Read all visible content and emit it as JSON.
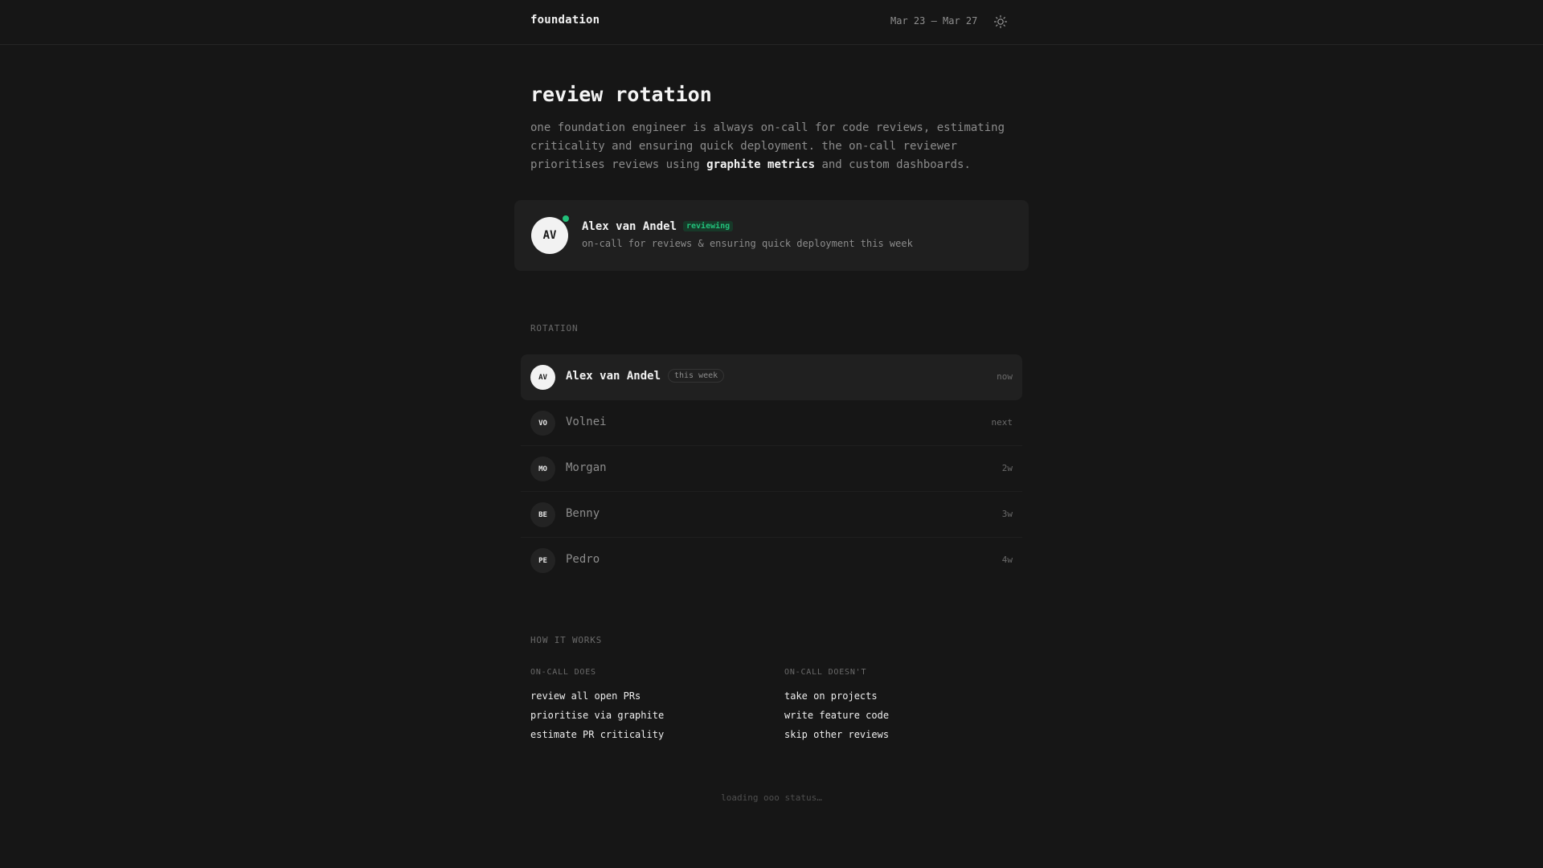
{
  "header": {
    "brand": "foundation",
    "date_range": "Mar 23 – Mar 27",
    "theme_icon": "sun-icon"
  },
  "page": {
    "title": "review rotation",
    "intro_before": "one foundation engineer is always on-call for code reviews, estimating criticality and ensuring quick deployment. the on-call reviewer prioritises reviews using ",
    "intro_link": "graphite metrics",
    "intro_after": " and custom dashboards."
  },
  "oncall": {
    "initials": "AV",
    "name": "Alex van Andel",
    "status_badge": "reviewing",
    "status_color": "#22c07a",
    "description": "on-call for reviews & ensuring quick deployment this week"
  },
  "rotation": {
    "label": "ROTATION",
    "members": [
      {
        "initials": "AV",
        "name": "Alex van Andel",
        "badge": "this week",
        "when": "now"
      },
      {
        "initials": "VO",
        "name": "Volnei",
        "when": "next"
      },
      {
        "initials": "MO",
        "name": "Morgan",
        "when": "2w"
      },
      {
        "initials": "BE",
        "name": "Benny",
        "when": "3w"
      },
      {
        "initials": "PE",
        "name": "Pedro",
        "when": "4w"
      }
    ]
  },
  "how_it_works": {
    "label": "HOW IT WORKS",
    "does": {
      "heading": "ON-CALL DOES",
      "items": [
        "review all open PRs",
        "prioritise via graphite",
        "estimate PR criticality"
      ]
    },
    "doesnt": {
      "heading": "ON-CALL DOESN'T",
      "items": [
        "take on projects",
        "write feature code",
        "skip other reviews"
      ]
    }
  },
  "footer": {
    "status": "loading ooo status…"
  }
}
